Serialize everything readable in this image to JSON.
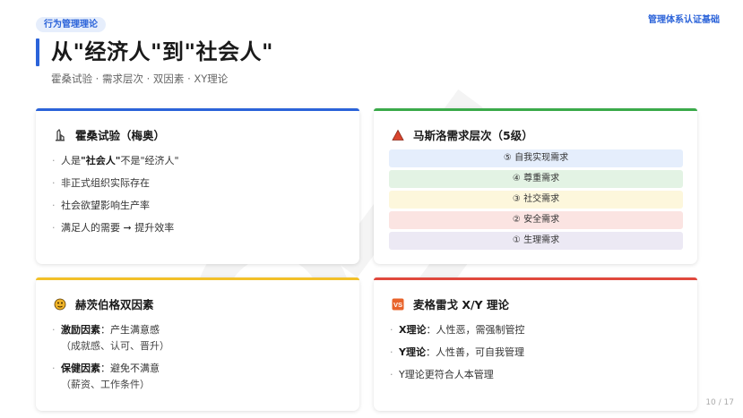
{
  "header": {
    "tag": "行为管理理论",
    "brand": "管理体系认证基础",
    "title": "从\"经济人\"到\"社会人\"",
    "subtitle": "霍桑试验 · 需求层次 · 双因素 · XY理论"
  },
  "colors": {
    "blue": "#2b63d9",
    "green": "#3aaa4a",
    "yellow": "#f2c028",
    "red": "#e0483d"
  },
  "cards": {
    "hawthorne": {
      "title": "霍桑试验（梅奥）",
      "icon": "flask-icon",
      "items": [
        {
          "pre": "人是",
          "bold": "\"社会人\"",
          "post": "不是\"经济人\""
        },
        {
          "text": "非正式组织实际存在"
        },
        {
          "text": "社会欲望影响生产率"
        },
        {
          "text": "满足人的需要 ➞ 提升效率"
        }
      ]
    },
    "maslow": {
      "title": "马斯洛需求层次（5级）",
      "icon": "triangle-icon",
      "levels": [
        "⑤ 自我实现需求",
        "④ 尊重需求",
        "③ 社交需求",
        "② 安全需求",
        "① 生理需求"
      ]
    },
    "herzberg": {
      "title": "赫茨伯格双因素",
      "icon": "masks-icon",
      "items": [
        {
          "bold": "激励因素",
          "post": "：产生满意感",
          "sub": "（成就感、认可、晋升）"
        },
        {
          "bold": "保健因素",
          "post": "：避免不满意",
          "sub": "（薪资、工作条件）"
        }
      ]
    },
    "mcgregor": {
      "title": "麦格雷戈 X/Y 理论",
      "icon": "vs-icon",
      "items": [
        {
          "bold": "X理论",
          "post": "：人性恶，需强制管控"
        },
        {
          "bold": "Y理论",
          "post": "：人性善，可自我管理"
        },
        {
          "text": "Y理论更符合人本管理"
        }
      ]
    }
  },
  "page": "10 / 17"
}
